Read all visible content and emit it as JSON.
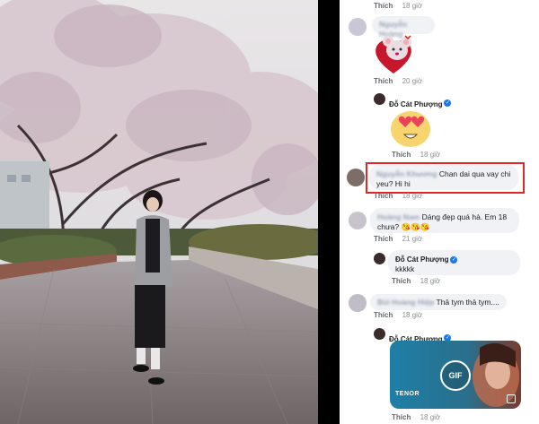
{
  "actions": {
    "like": "Thích"
  },
  "comments": [
    {
      "time": "18 giờ"
    },
    {
      "time": "20 giờ"
    },
    {
      "author": "Đỗ Cát Phượng",
      "time": "18 giờ"
    },
    {
      "text": "Chan dai qua vay chi yeu? Hi hi",
      "time": "18 giờ"
    },
    {
      "text": "Dáng đẹp quá hà. Em 18 chưa?",
      "emojis": "😘😘😘",
      "time": "21 giờ"
    },
    {
      "author": "Đỗ Cát Phượng",
      "text": "kkkkk",
      "time": "18 giờ"
    },
    {
      "text": "Thả tym thả tym....",
      "time": "18 giờ"
    },
    {
      "author": "Đỗ Cát Phượng",
      "gif_label": "GIF",
      "gif_source": "TENOR",
      "time": "18 giờ"
    }
  ]
}
